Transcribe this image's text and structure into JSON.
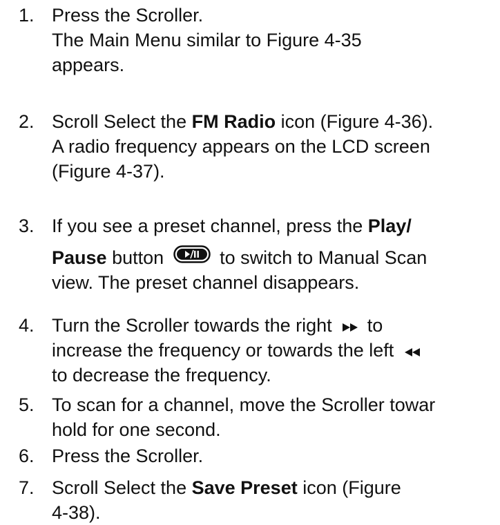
{
  "steps": [
    {
      "number": "1.",
      "line1": "Press the Scroller.",
      "line2": "The Main Menu similar to Figure 4-35",
      "line3": "appears."
    },
    {
      "number": "2.",
      "line1_a": "Scroll Select the ",
      "line1_b": "FM Radio",
      "line1_c": " icon (Figure 4-36).",
      "line2": "A radio frequency appears on the LCD screen",
      "line3": "(Figure 4-37)."
    },
    {
      "number": "3.",
      "line1_a": "If you see a preset channel, press the ",
      "line1_b": "Play/",
      "line2_a": "Pause",
      "line2_b": " button ",
      "line2_c": " to switch to Manual Scan",
      "line3": "view. The preset channel disappears."
    },
    {
      "number": "4.",
      "line1_a": "Turn the Scroller towards the right ",
      "line1_b": " to",
      "line2_a": "increase the frequency or towards the left ",
      "line3": "to decrease the frequency."
    },
    {
      "number": "5.",
      "line1": "To scan for a channel, move the Scroller towar",
      "line2": "hold for one second."
    },
    {
      "number": "6.",
      "line1": "Press the Scroller."
    },
    {
      "number": "7.",
      "line1_a": "Scroll Select the ",
      "line1_b": "Save Preset",
      "line1_c": " icon (Figure",
      "line2": "4-38)."
    }
  ],
  "icons": {
    "play_pause": "play-pause-button-icon",
    "fast_forward": "fast-forward-icon",
    "rewind": "rewind-icon"
  }
}
